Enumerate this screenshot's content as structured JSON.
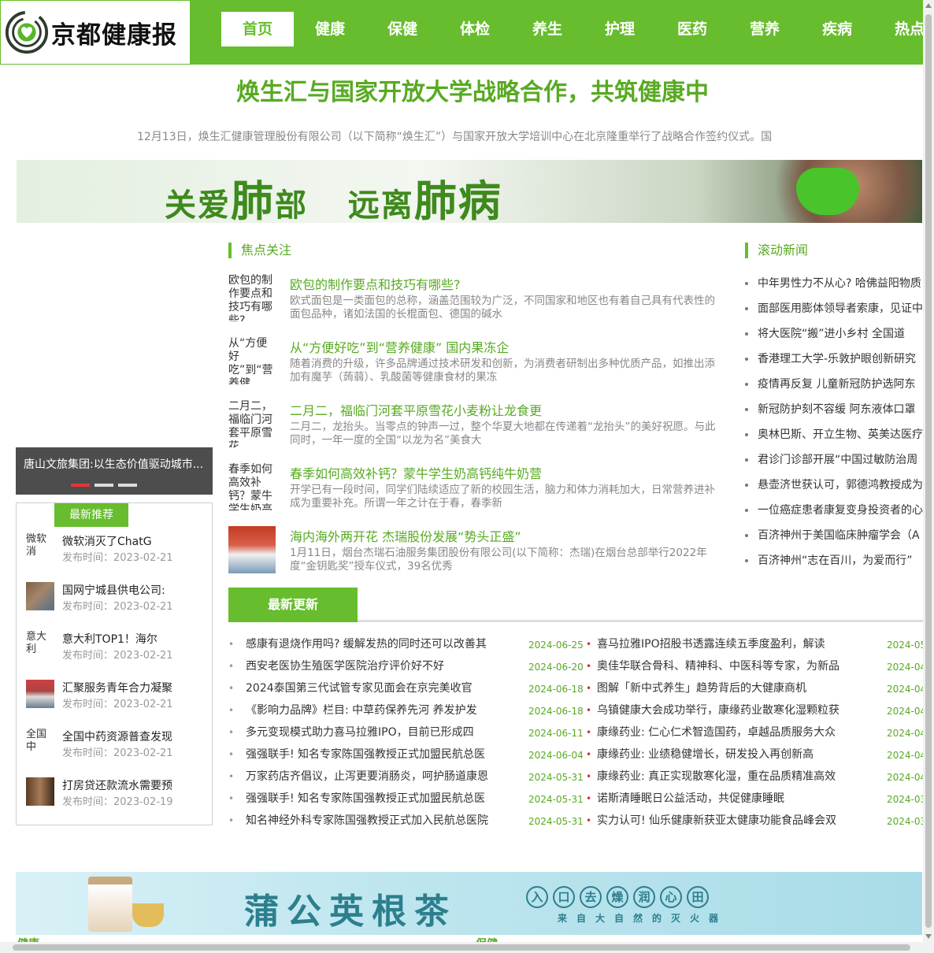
{
  "site": {
    "logo_text": "京都健康报"
  },
  "nav": [
    "首页",
    "健康",
    "保健",
    "体检",
    "养生",
    "护理",
    "医药",
    "营养",
    "疾病",
    "热点"
  ],
  "headline": {
    "title": "焕生汇与国家开放大学战略合作，共筑健康中",
    "summary": "12月13日，焕生汇健康管理股份有限公司（以下简称“焕生汇”）与国家开放大学培训中心在北京隆重举行了战略合作签约仪式。国"
  },
  "banner_top": {
    "text_a": "关爱",
    "text_b": "肺",
    "text_c": "部",
    "text_d": "远离",
    "text_e": "肺病"
  },
  "slider": {
    "caption": "唐山文旅集团:以生态价值驱动城市..."
  },
  "recommend": {
    "title": "最新推荐",
    "items": [
      {
        "thumb_alt": "微软消",
        "name": "微软消灭了ChatG",
        "date": "发布时间：2023-02-21",
        "has_image": false
      },
      {
        "thumb_alt": "",
        "name": "国网宁城县供电公司:",
        "date": "发布时间：2023-02-21",
        "has_image": true
      },
      {
        "thumb_alt": "意大利",
        "name": "意大利TOP1！海尔",
        "date": "发布时间：2023-02-21",
        "has_image": false
      },
      {
        "thumb_alt": "",
        "name": "汇聚服务青年合力凝聚",
        "date": "发布时间：2023-02-21",
        "has_image": true
      },
      {
        "thumb_alt": "全国中",
        "name": "全国中药资源普查发现",
        "date": "发布时间：2023-02-21",
        "has_image": false
      },
      {
        "thumb_alt": "",
        "name": "打房贷还款流水需要预",
        "date": "发布时间：2023-02-19",
        "has_image": true
      }
    ]
  },
  "focus": {
    "title": "焦点关注",
    "items": [
      {
        "thumb_alt": "欧包的制作要点和技巧有哪些?",
        "title": "欧包的制作要点和技巧有哪些?",
        "desc": "欧式面包是一类面包的总称，涵盖范围较为广泛，不同国家和地区也有着自己具有代表性的面包品种，诸如法国的长棍面包、德国的碱水",
        "has_image": false
      },
      {
        "thumb_alt": "从“方便好吃”到“营养健康”国",
        "title": "从“方便好吃”到“营养健康” 国内果冻企",
        "desc": "随着消费的升级，许多品牌通过技术研发和创新，为消费者研制出多种优质产品，如推出添加有魔芋（蒟蒻）、乳酸菌等健康食材的果冻",
        "has_image": false
      },
      {
        "thumb_alt": "二月二，福临门河套平原雪花",
        "title": "二月二，福临门河套平原雪花小麦粉让龙食更",
        "desc": "二月二，龙抬头。当零点的钟声一过，整个华夏大地都在传递着“龙抬头”的美好祝愿。与此同时，一年一度的全国“以龙为名”美食大",
        "has_image": false
      },
      {
        "thumb_alt": "春季如何高效补钙？蒙牛学生奶高",
        "title": "春季如何高效补钙？蒙牛学生奶高钙纯牛奶营",
        "desc": "开学已有一段时间，同学们陆续适应了新的校园生活，脑力和体力消耗加大，日常营养进补成为重要补充。所谓一年之计在于春，春季新",
        "has_image": false
      },
      {
        "thumb_alt": "",
        "title": "海内海外两开花 杰瑞股份发展“势头正盛”",
        "desc": "1月11日，烟台杰瑞石油服务集团股份有限公司(以下简称：杰瑞)在烟台总部举行2022年度“金钥匙奖”授车仪式，39名优秀",
        "has_image": true
      }
    ]
  },
  "scroll_news": {
    "title": "滚动新闻",
    "items": [
      "中年男性力不从心? 哈佛益阳物质",
      "面部医用膨体领导者索康，见证中",
      "将大医院“搬”进小乡村 全国道",
      "香港理工大学-乐敦护眼创新研究",
      "疫情再反复 儿童新冠防护选阿东",
      "新冠防护刻不容缓 阿东液体口罩",
      "奥林巴斯、开立生物、英美达医疗",
      "君诊门诊部开展“中国过敏防治周",
      "悬壶济世获认可，郭德鸿教授成为",
      "一位癌症患者康复变身投资者的心",
      "百济神州于美国临床肿瘤学会（A",
      "百济神州“志在百川，为爱而行”"
    ]
  },
  "updates": {
    "tab": "最新更新",
    "left": [
      {
        "title": "感康有退烧作用吗? 缓解发热的同时还可以改善其",
        "date": "2024-06-25"
      },
      {
        "title": "西安老医协生殖医学医院治疗评价好不好",
        "date": "2024-06-20"
      },
      {
        "title": "2024泰国第三代试管专家见面会在京完美收官",
        "date": "2024-06-18"
      },
      {
        "title": "《影响力品牌》栏目: 中草药保养先河 养发护发",
        "date": "2024-06-18"
      },
      {
        "title": "多元变现模式助力喜马拉雅IPO，目前已形成四",
        "date": "2024-06-11"
      },
      {
        "title": "强强联手! 知名专家陈国强教授正式加盟民航总医",
        "date": "2024-06-04"
      },
      {
        "title": "万家药店齐倡议，止泻更要消肠炎，呵护肠道康恩",
        "date": "2024-05-31"
      },
      {
        "title": "强强联手! 知名专家陈国强教授正式加盟民航总医",
        "date": "2024-05-31"
      },
      {
        "title": "知名神经外科专家陈国强教授正式加入民航总医院",
        "date": "2024-05-31"
      }
    ],
    "right": [
      {
        "title": "喜马拉雅IPO招股书透露连续五季度盈利，解读",
        "date": "2024-05-"
      },
      {
        "title": "奥佳华联合骨科、精神科、中医科等专家，为新品",
        "date": "2024-04-"
      },
      {
        "title": "图解「新中式养生」趋势背后的大健康商机",
        "date": "2024-04-"
      },
      {
        "title": "乌镇健康大会成功举行，康缘药业散寒化湿颗粒获",
        "date": "2024-04-"
      },
      {
        "title": "康缘药业: 仁心仁术智造国药，卓越品质服务大众",
        "date": "2024-04-"
      },
      {
        "title": "康缘药业: 业绩稳健增长，研发投入再创新高",
        "date": "2024-04-"
      },
      {
        "title": "康缘药业: 真正实现散寒化湿，重在品质精准高效",
        "date": "2024-04-"
      },
      {
        "title": "诺斯清睡眠日公益活动，共促健康睡眠",
        "date": "2024-03-"
      },
      {
        "title": "实力认可! 仙乐健康新获亚太健康功能食品峰会双",
        "date": "2024-03-"
      }
    ]
  },
  "banner_bottom": {
    "title": "蒲公英根茶",
    "chars": [
      "入",
      "口",
      "去",
      "燥",
      "润",
      "心",
      "田"
    ],
    "sub": "来自大自然的灭火器"
  },
  "bottom_heads": {
    "left": "健康",
    "right": "保健"
  },
  "colors": {
    "brand_green": "#67bd2d",
    "title_green": "#58aa22"
  }
}
